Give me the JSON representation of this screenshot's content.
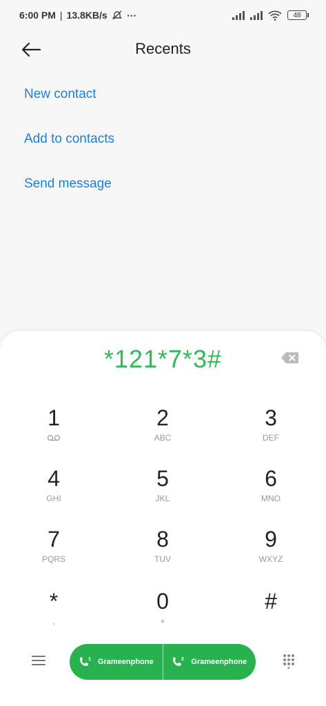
{
  "status": {
    "time": "6:00 PM",
    "speed": "13.8KB/s",
    "more": "⋯",
    "battery": "48"
  },
  "header": {
    "title": "Recents"
  },
  "actions": {
    "new_contact": "New contact",
    "add_to_contacts": "Add to contacts",
    "send_message": "Send message"
  },
  "dialer": {
    "number": "*121*7*3#",
    "keys": [
      {
        "digit": "1",
        "letters": ""
      },
      {
        "digit": "2",
        "letters": "ABC"
      },
      {
        "digit": "3",
        "letters": "DEF"
      },
      {
        "digit": "4",
        "letters": "GHI"
      },
      {
        "digit": "5",
        "letters": "JKL"
      },
      {
        "digit": "6",
        "letters": "MNO"
      },
      {
        "digit": "7",
        "letters": "PQRS"
      },
      {
        "digit": "8",
        "letters": "TUV"
      },
      {
        "digit": "9",
        "letters": "WXYZ"
      },
      {
        "digit": "*",
        "letters": ","
      },
      {
        "digit": "0",
        "letters": "+"
      },
      {
        "digit": "#",
        "letters": ""
      }
    ],
    "sim1_label": "Grameenphone",
    "sim2_label": "Grameenphone",
    "sim1_number": "1",
    "sim2_number": "2"
  },
  "colors": {
    "accent_blue": "#1f7fd0",
    "accent_green": "#2dbb54",
    "call_green": "#27b14f"
  }
}
